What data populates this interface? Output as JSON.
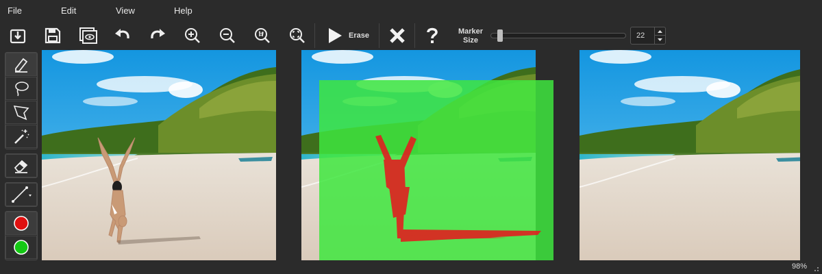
{
  "menu": {
    "file": "File",
    "edit": "Edit",
    "view": "View",
    "help": "Help"
  },
  "toolbar": {
    "erase_label": "Erase",
    "marker_size_line1": "Marker",
    "marker_size_line2": "Size",
    "marker_size_value": "22",
    "slider_level": 0.05
  },
  "tools": {
    "icons": [
      "marker-pen-icon",
      "lasso-icon",
      "polygon-lasso-icon",
      "magic-wand-icon",
      "eraser-icon",
      "line-icon"
    ],
    "colors": {
      "red": "#e01010",
      "green": "#14c814"
    }
  },
  "status": {
    "zoom": "98%"
  },
  "colors": {
    "background": "#2b2b2b",
    "overlay_green": "#3ee63e",
    "overlay_red": "#e02020"
  }
}
